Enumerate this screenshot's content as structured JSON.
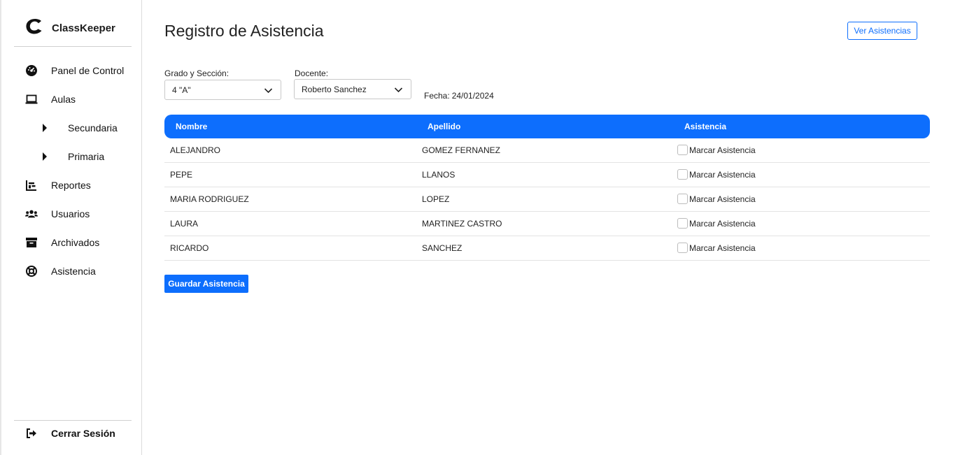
{
  "app": {
    "name": "ClassKeeper"
  },
  "sidebar": {
    "items": [
      {
        "label": "Panel de Control",
        "icon": "dashboard-icon"
      },
      {
        "label": "Aulas",
        "icon": "laptop-icon"
      },
      {
        "label": "Secundaria",
        "icon": "caret-right-icon"
      },
      {
        "label": "Primaria",
        "icon": "caret-right-icon"
      },
      {
        "label": "Reportes",
        "icon": "chart-icon"
      },
      {
        "label": "Usuarios",
        "icon": "users-icon"
      },
      {
        "label": "Archivados",
        "icon": "archive-icon"
      },
      {
        "label": "Asistencia",
        "icon": "lifering-icon"
      }
    ],
    "logout": {
      "label": "Cerrar Sesión",
      "icon": "sign-out-icon"
    }
  },
  "main": {
    "title": "Registro de Asistencia",
    "view_button": "Ver Asistencias",
    "filters": {
      "grade_label": "Grado y Sección:",
      "grade_value": "4 \"A\"",
      "teacher_label": "Docente:",
      "teacher_value": "Roberto Sanchez",
      "date_label": "Fecha:",
      "date_value": "24/01/2024"
    },
    "table": {
      "headers": [
        "Nombre",
        "Apellido",
        "Asistencia"
      ],
      "rows": [
        {
          "nombre": "ALEJANDRO",
          "apellido": "GOMEZ FERNANEZ",
          "asistencia": "Marcar Asistencia"
        },
        {
          "nombre": "PEPE",
          "apellido": "LLANOS",
          "asistencia": "Marcar Asistencia"
        },
        {
          "nombre": "MARIA RODRIGUEZ",
          "apellido": "LOPEZ",
          "asistencia": "Marcar Asistencia"
        },
        {
          "nombre": "LAURA",
          "apellido": "MARTINEZ CASTRO",
          "asistencia": "Marcar Asistencia"
        },
        {
          "nombre": "RICARDO",
          "apellido": "SANCHEZ",
          "asistencia": "Marcar Asistencia"
        }
      ]
    },
    "save_button": "Guardar Asistencia"
  },
  "colors": {
    "primary": "#0d6efd",
    "text": "#212529",
    "border": "#e3e3e3"
  }
}
